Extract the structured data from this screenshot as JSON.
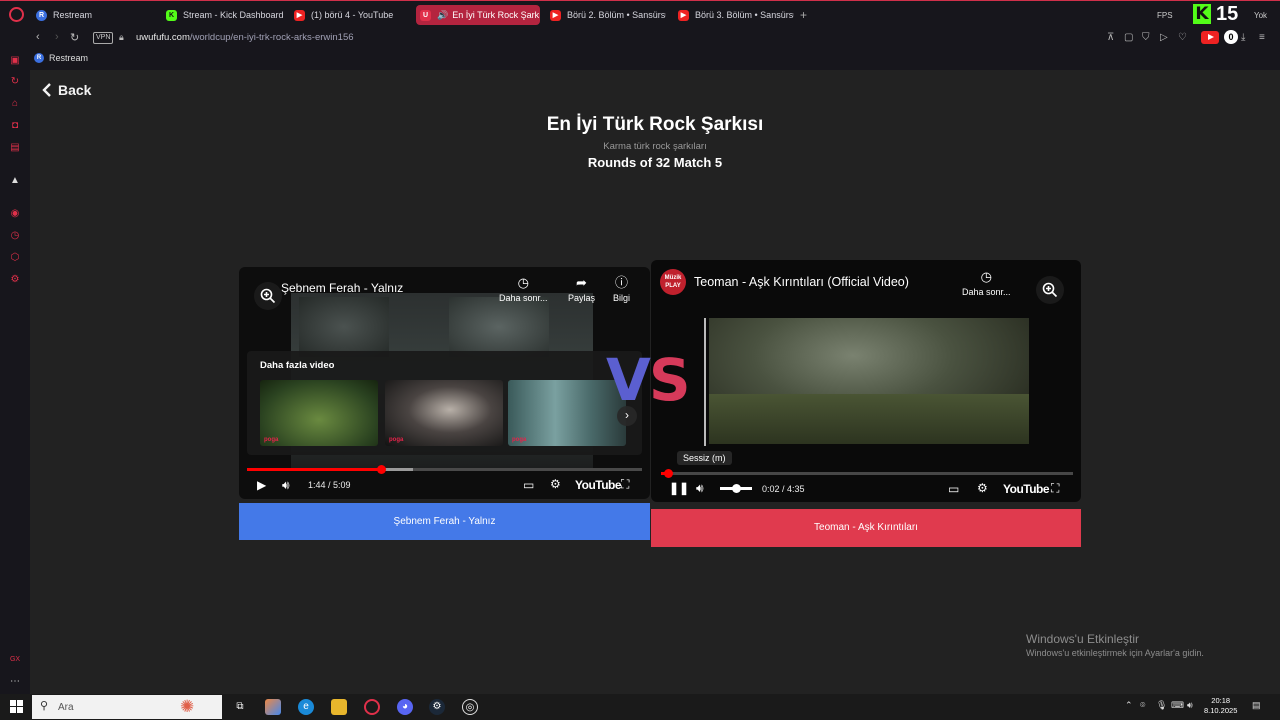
{
  "browser": {
    "tabs": [
      {
        "label": "Restream",
        "icon": "restream-icon"
      },
      {
        "label": "Stream - Kick Dashboard",
        "icon": "kick-icon"
      },
      {
        "label": "(1) börü 4 - YouTube",
        "icon": "youtube-icon"
      },
      {
        "label": "En İyi Türk Rock Şarkı",
        "icon": "uwufufu-icon",
        "active": true
      },
      {
        "label": "Börü 2. Bölüm • Sansürsü",
        "icon": "youtube-icon"
      },
      {
        "label": "Börü 3. Bölüm • Sansürsü",
        "icon": "youtube-icon"
      }
    ],
    "new_tab": "+",
    "fps_label": "FPS",
    "kick_logo": "K",
    "kick_count": "15",
    "yok_label": "Yok",
    "vpn": "VPN",
    "url_domain": "uwufufu.com",
    "url_path": "/worldcup/en-iyi-trk-rock-arks-erwin156",
    "yt_badge_count": "0",
    "bookmark": {
      "label": "Restream",
      "icon_letter": "R"
    }
  },
  "page": {
    "back_label": "Back",
    "title": "En İyi Türk Rock Şarkısı",
    "subtitle": "Karma türk rock şarkıları",
    "round": "Rounds of 32 Match 5",
    "vs_v": "V",
    "vs_s": "S"
  },
  "left_video": {
    "title": "Şebnem Ferah - Yalnız",
    "later": "Daha sonr...",
    "share": "Paylaş",
    "info": "Bilgi",
    "more_videos": "Daha fazla video",
    "thumb_tag": "poga",
    "time": "1:44 / 5:09",
    "youtube": "YouTube",
    "played_fraction": 0.34,
    "buffered_fraction": 0.42,
    "choice_label": "Şebnem Ferah - Yalnız"
  },
  "right_video": {
    "channel_logo": "Müzik PLAY",
    "title": "Teoman - Aşk Kırıntıları (Official Video)",
    "later": "Daha sonr...",
    "tooltip": "Sessiz (m)",
    "time": "0:02 / 4:35",
    "youtube": "YouTube",
    "played_fraction": 0.01,
    "volume_fraction": 0.5,
    "choice_label": "Teoman - Aşk Kırıntıları"
  },
  "desktop": {
    "activate_title": "Windows'u Etkinleştir",
    "activate_sub": "Windows'u etkinleştirmek için Ayarlar'a gidin.",
    "search_placeholder": "Ara",
    "clock_time": "20:18",
    "clock_date": "8.10.2025"
  }
}
